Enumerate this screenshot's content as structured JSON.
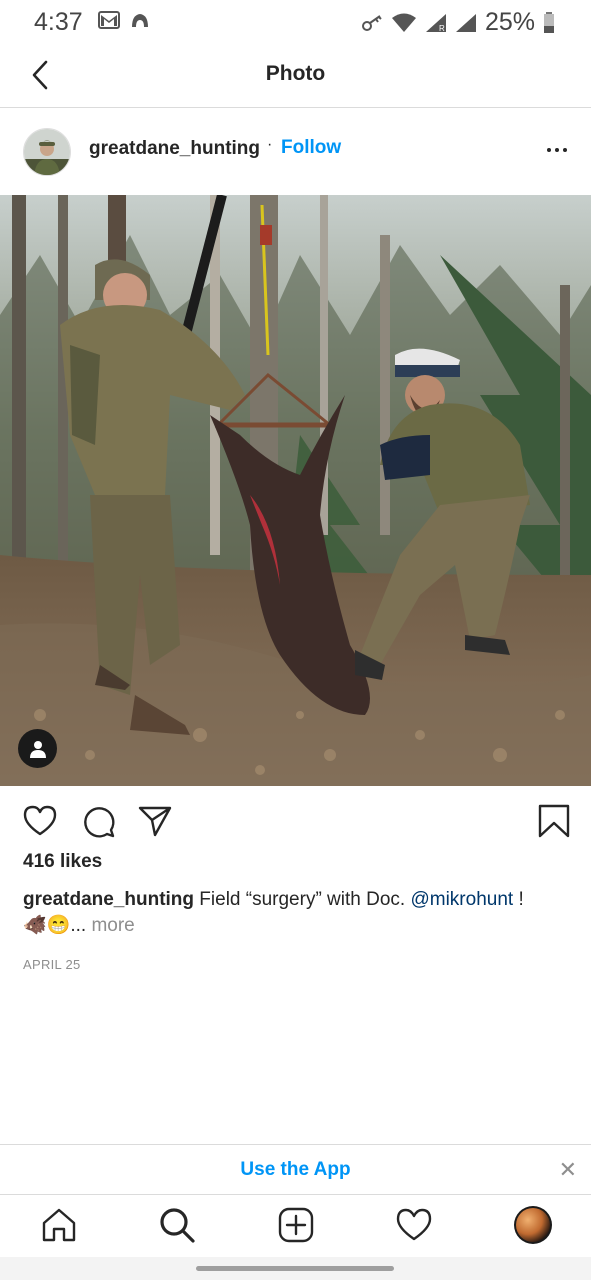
{
  "status_bar": {
    "time": "4:37",
    "battery": "25%"
  },
  "header": {
    "title": "Photo"
  },
  "post": {
    "username": "greatdane_hunting",
    "separator": "·",
    "follow_label": "Follow",
    "likes": "416 likes",
    "caption": {
      "username": "greatdane_hunting",
      "text": "Field “surgery” with Doc.",
      "mention": "@mikrohunt",
      "text_after": "!",
      "emoji": "🐗😁",
      "ellipsis": "...",
      "more_label": "more"
    },
    "date": "APRIL 25"
  },
  "banner": {
    "label": "Use the App",
    "close": "✕"
  },
  "colors": {
    "accent": "#0095f6",
    "mention": "#00376b",
    "muted": "#8e8e8e",
    "text": "#262626",
    "border": "#dbdbdb"
  },
  "icons": [
    "back-arrow-icon",
    "more-options-icon",
    "user-tag-icon",
    "heart-icon",
    "comment-icon",
    "share-icon",
    "bookmark-icon",
    "home-icon",
    "search-icon",
    "new-post-icon",
    "activity-heart-icon",
    "profile-avatar-icon"
  ]
}
